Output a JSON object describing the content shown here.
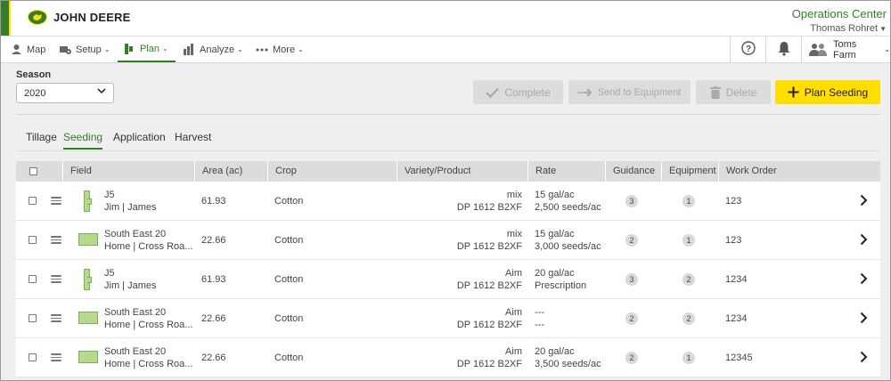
{
  "brand": {
    "name": "JOHN DEERE"
  },
  "header": {
    "app_title": "Operations Center",
    "user": "Thomas Rohret"
  },
  "nav": {
    "items": [
      {
        "label": "Map",
        "icon": "map-pin-icon",
        "caret": false
      },
      {
        "label": "Setup",
        "icon": "setup-icon",
        "caret": true
      },
      {
        "label": "Plan",
        "icon": "plan-icon",
        "caret": true,
        "active": true
      },
      {
        "label": "Analyze",
        "icon": "bar-chart-icon",
        "caret": true
      },
      {
        "label": "More",
        "icon": "more-dots-icon",
        "caret": true
      }
    ],
    "org": "Toms Farm"
  },
  "toolbar": {
    "season_label": "Season",
    "season_value": "2020",
    "complete_label": "Complete",
    "send_label": "Send to Equipment",
    "delete_label": "Delete",
    "plan_label": "Plan Seeding"
  },
  "tabs": [
    "Tillage",
    "Seeding",
    "Application",
    "Harvest"
  ],
  "active_tab": "Seeding",
  "table": {
    "columns": [
      "Field",
      "Area (ac)",
      "Crop",
      "Variety/Product",
      "Rate",
      "Guidance",
      "Equipment",
      "Work Order"
    ],
    "rows": [
      {
        "shape": "j",
        "field": "J5",
        "subfield": "Jim | James",
        "area": "61.93",
        "crop": "Cotton",
        "variety1": "mix",
        "variety2": "DP 1612 B2XF",
        "rate1": "15 gal/ac",
        "rate2": "2,500 seeds/ac",
        "guidance": "3",
        "equipment": "1",
        "work_order": "123"
      },
      {
        "shape": "rect",
        "field": "South East 20",
        "subfield": "Home | Cross Roa...",
        "area": "22.66",
        "crop": "Cotton",
        "variety1": "mix",
        "variety2": "DP 1612 B2XF",
        "rate1": "15 gal/ac",
        "rate2": "3,000 seeds/ac",
        "guidance": "2",
        "equipment": "1",
        "work_order": "123"
      },
      {
        "shape": "j",
        "field": "J5",
        "subfield": "Jim | James",
        "area": "61.93",
        "crop": "Cotton",
        "variety1": "Aim",
        "variety2": "DP 1612 B2XF",
        "rate1": "20 gal/ac",
        "rate2": "Prescription",
        "guidance": "3",
        "equipment": "2",
        "work_order": "1234"
      },
      {
        "shape": "rect",
        "field": "South East 20",
        "subfield": "Home | Cross Roa...",
        "area": "22.66",
        "crop": "Cotton",
        "variety1": "Aim",
        "variety2": "DP 1612 B2XF",
        "rate1": "---",
        "rate2": "---",
        "guidance": "2",
        "equipment": "2",
        "work_order": "1234"
      },
      {
        "shape": "rect",
        "field": "South East 20",
        "subfield": "Home | Cross Roa...",
        "area": "22.66",
        "crop": "Cotton",
        "variety1": "Aim",
        "variety2": "DP 1612 B2XF",
        "rate1": "20 gal/ac",
        "rate2": "3,500 seeds/ac",
        "guidance": "2",
        "equipment": "1",
        "work_order": "12345"
      }
    ]
  },
  "colors": {
    "brand_green": "#367c2b",
    "brand_yellow": "#ffde00",
    "field_fill": "#b5d98f"
  }
}
